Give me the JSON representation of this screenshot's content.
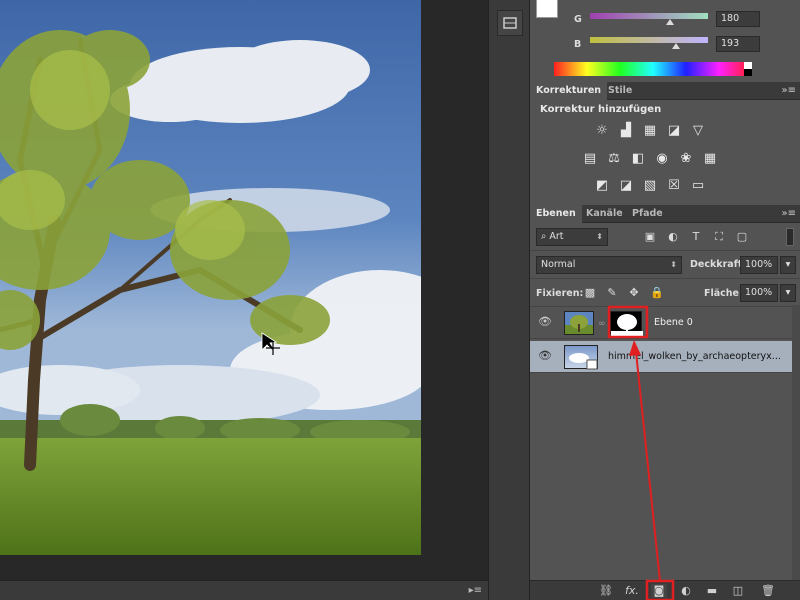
{
  "color_panel": {
    "sliders": [
      {
        "label": "G",
        "value": "180",
        "fraction": 0.68
      },
      {
        "label": "B",
        "value": "193",
        "fraction": 0.73
      }
    ]
  },
  "adjustments": {
    "tabs": [
      "Korrekturen",
      "Stile"
    ],
    "title": "Korrektur hinzufügen"
  },
  "layers": {
    "tabs": [
      "Ebenen",
      "Kanäle",
      "Pfade"
    ],
    "filter_kind": "Art",
    "blend_mode": "Normal",
    "opacity_label": "Deckkraft:",
    "opacity_value": "100%",
    "lock_label": "Fixieren:",
    "fill_label": "Fläche:",
    "fill_value": "100%",
    "items": [
      {
        "name": "Ebene 0",
        "selected": false,
        "visible": true,
        "has_mask": true
      },
      {
        "name": "himmel_wolken_by_archaeopteryx...",
        "selected": true,
        "visible": true,
        "has_mask": false
      }
    ],
    "footer_fx": "fx."
  },
  "colors": {
    "panel_bg": "#535353",
    "selected_row": "#a6b0bd",
    "annotation_red": "#e02020"
  }
}
